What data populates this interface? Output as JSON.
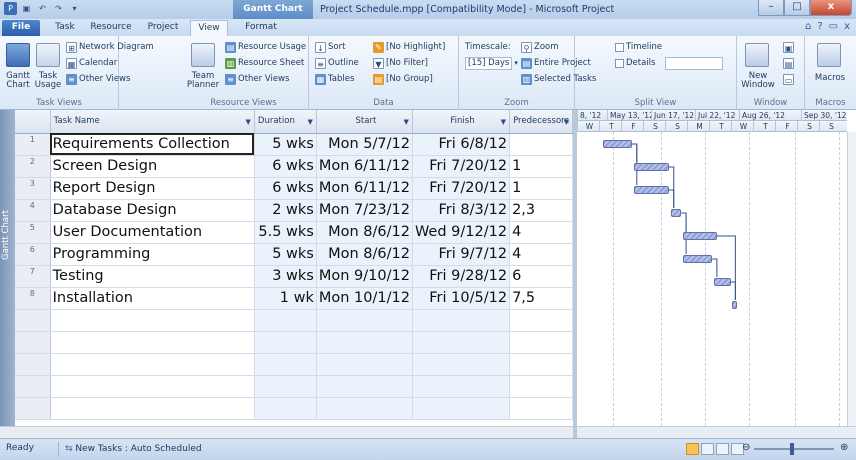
{
  "titlebar": {
    "context_tab_title": "Gantt Chart Tools",
    "window_title": "Project Schedule.mpp [Compatibility Mode]  -  Microsoft Project",
    "minimize": "–",
    "maximize": "□",
    "close": "x"
  },
  "tabs": {
    "file": "File",
    "task": "Task",
    "resource": "Resource",
    "project": "Project",
    "view": "View",
    "format": "Format"
  },
  "ribbon": {
    "task_views": {
      "gantt": "Gantt Chart",
      "task_usage": "Task Usage",
      "network_diagram": "Network Diagram",
      "calendar": "Calendar",
      "other_views": "Other Views",
      "label": "Task Views"
    },
    "resource_views": {
      "team_planner": "Team Planner",
      "resource_usage": "Resource Usage",
      "resource_sheet": "Resource Sheet",
      "other_views": "Other Views",
      "label": "Resource Views"
    },
    "data": {
      "sort": "Sort",
      "outline": "Outline",
      "tables": "Tables",
      "highlight": "[No Highlight]",
      "filter": "[No Filter]",
      "group": "[No Group]",
      "label": "Data"
    },
    "zoom": {
      "timescale_label": "Timescale:",
      "timescale_value": "[15] Days",
      "zoom": "Zoom",
      "entire_project": "Entire Project",
      "selected_tasks": "Selected Tasks",
      "label": "Zoom"
    },
    "split_view": {
      "timeline": "Timeline",
      "details": "Details",
      "label": "Split View"
    },
    "window": {
      "new_window": "New Window",
      "label": "Window"
    },
    "macros": {
      "macros": "Macros",
      "label": "Macros"
    }
  },
  "grid": {
    "view_bar_label": "Gantt Chart",
    "columns": [
      "Task Name",
      "Duration",
      "Start",
      "Finish",
      "Predecessors"
    ],
    "rows": [
      {
        "id": "1",
        "name": "Requirements Collection",
        "duration": "5 wks",
        "start": "Mon 5/7/12",
        "finish": "Fri 6/8/12",
        "pred": ""
      },
      {
        "id": "2",
        "name": "Screen Design",
        "duration": "6 wks",
        "start": "Mon 6/11/12",
        "finish": "Fri 7/20/12",
        "pred": "1"
      },
      {
        "id": "3",
        "name": "Report Design",
        "duration": "6 wks",
        "start": "Mon 6/11/12",
        "finish": "Fri 7/20/12",
        "pred": "1"
      },
      {
        "id": "4",
        "name": "Database Design",
        "duration": "2 wks",
        "start": "Mon 7/23/12",
        "finish": "Fri 8/3/12",
        "pred": "2,3"
      },
      {
        "id": "5",
        "name": "User Documentation",
        "duration": "5.5 wks",
        "start": "Mon 8/6/12",
        "finish": "Wed 9/12/12",
        "pred": "4"
      },
      {
        "id": "6",
        "name": "Programming",
        "duration": "5 wks",
        "start": "Mon 8/6/12",
        "finish": "Fri 9/7/12",
        "pred": "4"
      },
      {
        "id": "7",
        "name": "Testing",
        "duration": "3 wks",
        "start": "Mon 9/10/12",
        "finish": "Fri 9/28/12",
        "pred": "6"
      },
      {
        "id": "8",
        "name": "Installation",
        "duration": "1 wk",
        "start": "Mon 10/1/12",
        "finish": "Fri 10/5/12",
        "pred": "7,5"
      }
    ]
  },
  "timescale": {
    "major": [
      "8, '12",
      "May 13, '12",
      "Jun 17, '12",
      "Jul 22, '12",
      "Aug 26, '12",
      "Sep 30, '12"
    ],
    "minor": [
      "W",
      "T",
      "F",
      "S",
      "S",
      "M",
      "T",
      "W",
      "T",
      "F",
      "S",
      "S"
    ]
  },
  "statusbar": {
    "ready": "Ready",
    "task_mode": "New Tasks : Auto Scheduled"
  },
  "colors": {
    "bar_fill": "#8f9fd6",
    "bar_border": "#5f6fab",
    "ribbon_bg": "#dce8f6",
    "file_tab": "#2a5ea8"
  }
}
